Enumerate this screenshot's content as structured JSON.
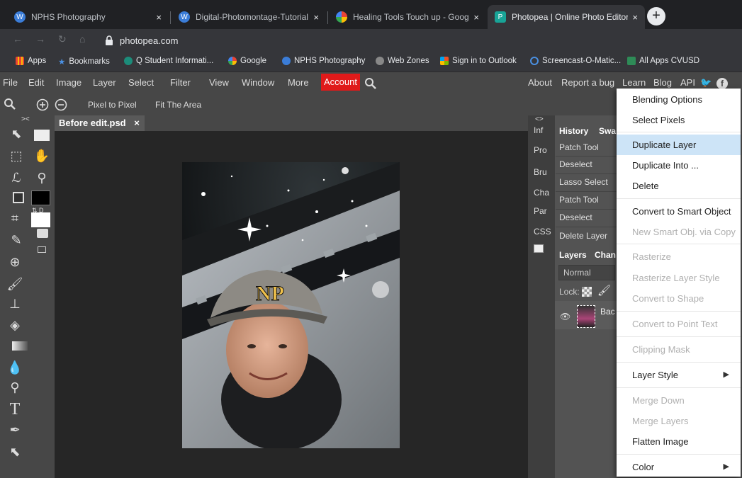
{
  "browser": {
    "tabs": [
      {
        "title": "NPHS Photography",
        "close": "×"
      },
      {
        "title": "Digital-Photomontage-Tutorial.p",
        "close": "×"
      },
      {
        "title": "Healing Tools Touch up - Google",
        "close": "×"
      },
      {
        "title": "Photopea | Online Photo Editor",
        "close": "×"
      }
    ],
    "new_tab": "+",
    "url": "photopea.com",
    "bookmarks": [
      {
        "label": "Apps"
      },
      {
        "label": "Bookmarks"
      },
      {
        "label": "Q Student Informati..."
      },
      {
        "label": "Google"
      },
      {
        "label": "NPHS Photography"
      },
      {
        "label": "Web Zones"
      },
      {
        "label": "Sign in to Outlook"
      },
      {
        "label": "Screencast-O-Matic..."
      },
      {
        "label": "All Apps CVUSD"
      }
    ]
  },
  "menubar": {
    "items": [
      "File",
      "Edit",
      "Image",
      "Layer",
      "Select",
      "Filter",
      "View",
      "Window",
      "More"
    ],
    "account": "Account",
    "right": [
      "About",
      "Report a bug",
      "Learn",
      "Blog",
      "API"
    ]
  },
  "zoombar": {
    "pixel_to_pixel": "Pixel to Pixel",
    "fit_area": "Fit The Area"
  },
  "document": {
    "tab": "Before edit.psd",
    "close": "×"
  },
  "panel_toggle": {
    "left": "><",
    "right": "<>"
  },
  "side_tabs": [
    "Inf",
    "Pro",
    "Bru",
    "Cha",
    "Par",
    "CSS"
  ],
  "history": {
    "tabs": [
      "History",
      "Swa"
    ],
    "items": [
      "Patch Tool",
      "Deselect",
      "Lasso Select",
      "Patch Tool",
      "Deselect",
      "Delete Layer"
    ]
  },
  "layers": {
    "tabs": [
      "Layers",
      "Chan"
    ],
    "blend_mode": "Normal",
    "lock_label": "Lock:",
    "layer_name": "Bac"
  },
  "context_menu": {
    "items": [
      {
        "label": "Blending Options",
        "enabled": true
      },
      {
        "label": "Select Pixels",
        "enabled": true
      },
      {
        "label": "Duplicate Layer",
        "enabled": true,
        "highlighted": true
      },
      {
        "label": "Duplicate Into ...",
        "enabled": true
      },
      {
        "label": "Delete",
        "enabled": true
      },
      {
        "label": "Convert to Smart Object",
        "enabled": true
      },
      {
        "label": "New Smart Obj. via Copy",
        "enabled": false
      },
      {
        "label": "Rasterize",
        "enabled": false
      },
      {
        "label": "Rasterize Layer Style",
        "enabled": false
      },
      {
        "label": "Convert to Shape",
        "enabled": false
      },
      {
        "label": "Convert to Point Text",
        "enabled": false
      },
      {
        "label": "Clipping Mask",
        "enabled": false
      },
      {
        "label": "Layer Style",
        "enabled": true,
        "submenu": true
      },
      {
        "label": "Merge Down",
        "enabled": false
      },
      {
        "label": "Merge Layers",
        "enabled": false
      },
      {
        "label": "Flatten Image",
        "enabled": true
      },
      {
        "label": "Color",
        "enabled": true,
        "submenu": true
      }
    ]
  },
  "colors": {
    "account": "#e01a1a",
    "highlight": "#cde4f7"
  }
}
